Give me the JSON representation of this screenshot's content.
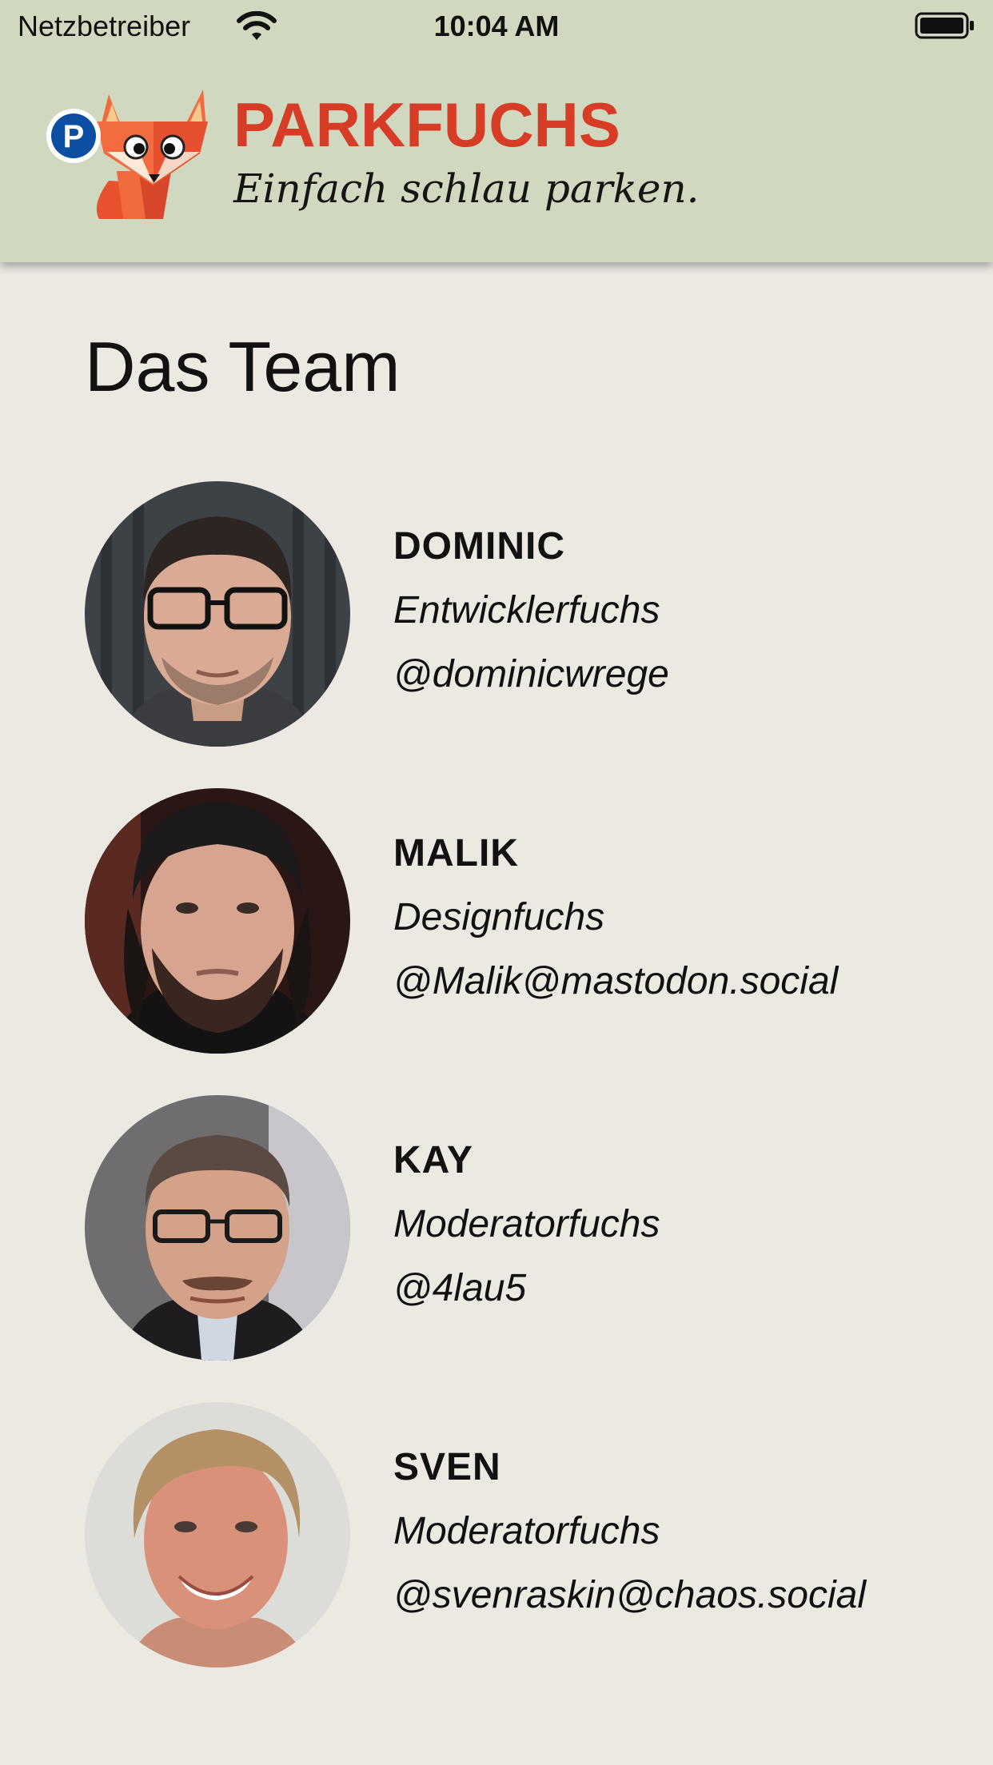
{
  "status_bar": {
    "carrier": "Netzbetreiber",
    "time": "10:04 AM"
  },
  "header": {
    "logo_badge_letter": "P",
    "title": "PARKFUCHS",
    "tagline": "Einfach schlau parken."
  },
  "page": {
    "title": "Das Team"
  },
  "team": [
    {
      "name": "DOMINIC",
      "role": "Entwicklerfuchs",
      "handle": "@dominicwrege"
    },
    {
      "name": "MALIK",
      "role": "Designfuchs",
      "handle": "@Malik@mastodon.social"
    },
    {
      "name": "KAY",
      "role": "Moderatorfuchs",
      "handle": "@4lau5"
    },
    {
      "name": "SVEN",
      "role": "Moderatorfuchs",
      "handle": "@svenraskin@chaos.social"
    }
  ],
  "colors": {
    "header_background": "#d0d8bf",
    "page_background": "#ece9e2",
    "brand_red": "#d63c26",
    "badge_blue": "#0c4ea2"
  },
  "icons": {
    "wifi": "wifi-icon",
    "battery": "battery-icon",
    "logo": "parkfuchs-fox-logo"
  }
}
